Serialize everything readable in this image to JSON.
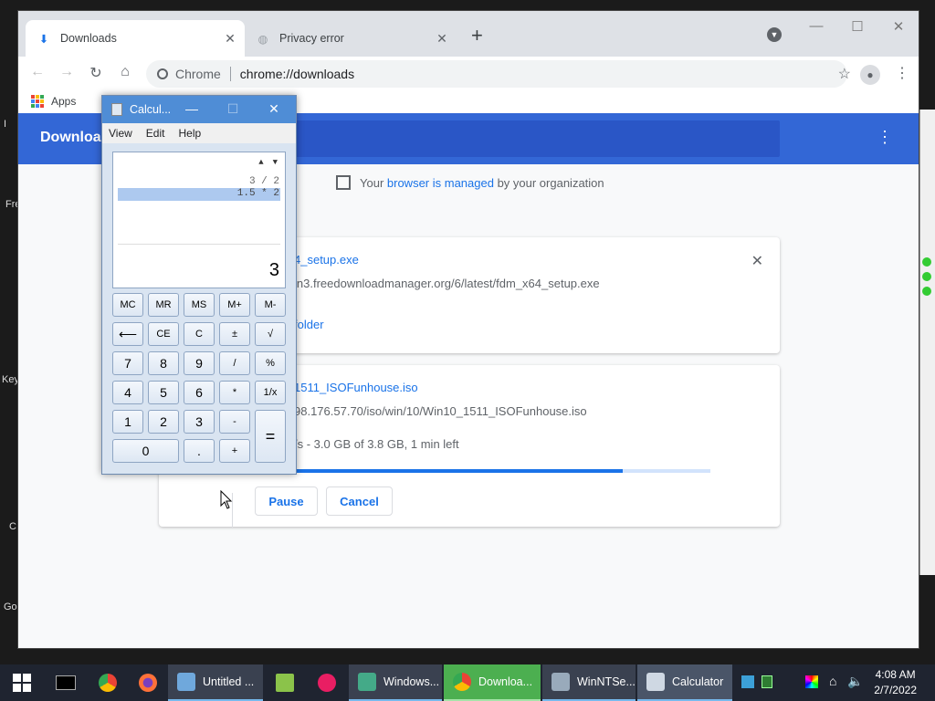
{
  "chrome": {
    "tabs": [
      {
        "label": "Downloads",
        "active": true
      },
      {
        "label": "Privacy error",
        "active": false
      }
    ],
    "address": {
      "site_label": "Chrome",
      "url": "chrome://downloads"
    },
    "bookmarks": {
      "apps_label": "Apps"
    },
    "page": {
      "header_title": "Downloads",
      "managed": {
        "pre": "Your ",
        "link": "browser is managed",
        "post": " by your organization"
      },
      "downloads": [
        {
          "filename": "fdm_x64_setup.exe",
          "filename_visible": "4_setup.exe",
          "url_visible": "ln3.freedownloadmanager.org/6/latest/fdm_x64_setup.exe",
          "action": "Show in folder",
          "action_visible": "folder"
        },
        {
          "filename_visible": "1511_ISOFunhouse.iso",
          "url_visible": "98.176.57.70/iso/win/10/Win10_1511_ISOFunhouse.iso",
          "status_visible": "/s - 3.0 GB of 3.8 GB, 1 min left",
          "progress": 0.79,
          "pause_label": "Pause",
          "cancel_label": "Cancel"
        }
      ]
    }
  },
  "calculator": {
    "title": "Calcul...",
    "menu": [
      "View",
      "Edit",
      "Help"
    ],
    "history": [
      "3 / 2",
      "1.5 * 2"
    ],
    "result": "3",
    "buttons": {
      "memory": [
        "MC",
        "MR",
        "MS",
        "M+",
        "M-"
      ],
      "row2": [
        "⟵",
        "CE",
        "C",
        "±",
        "√"
      ],
      "row3": [
        "7",
        "8",
        "9",
        "/",
        "%"
      ],
      "row4": [
        "4",
        "5",
        "6",
        "*",
        "1/x"
      ],
      "row5": [
        "1",
        "2",
        "3",
        "-",
        "="
      ],
      "row6": [
        "0",
        ".",
        "+"
      ]
    }
  },
  "desktop": {
    "labels": [
      "Fre",
      "Key",
      "C",
      "Go",
      "I"
    ]
  },
  "taskbar": {
    "items": [
      "Untitled ...",
      "Windows...",
      "Downloa...",
      "WinNTSe...",
      "Calculator"
    ],
    "time": "4:08 AM",
    "date": "2/7/2022"
  }
}
